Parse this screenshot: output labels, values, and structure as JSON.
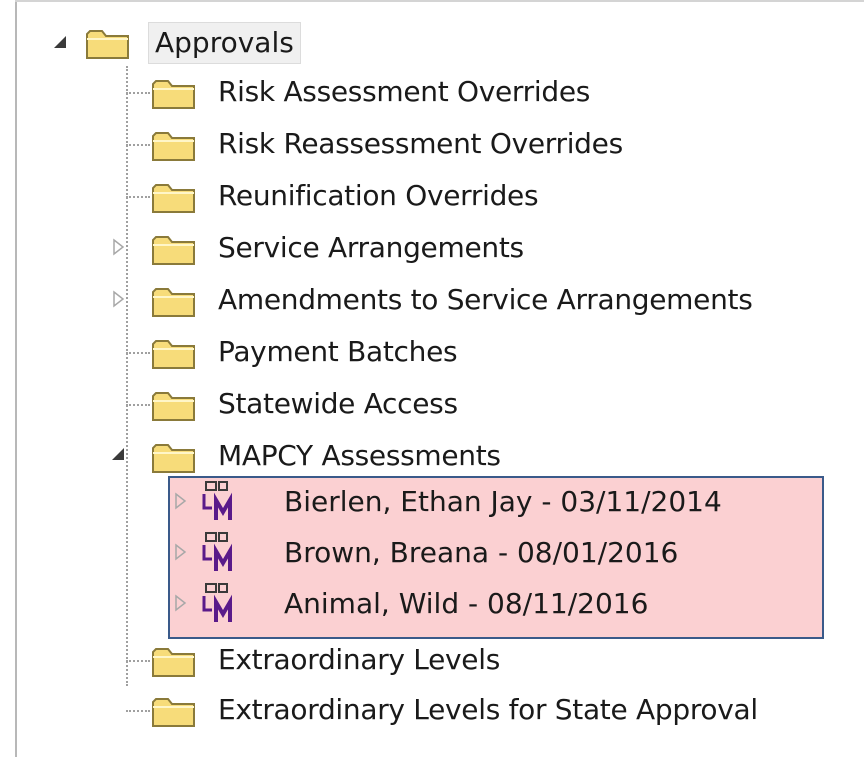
{
  "tree": {
    "root": {
      "label": "Approvals",
      "expanded": true
    },
    "items": [
      {
        "label": "Risk Assessment Overrides",
        "expandable": false
      },
      {
        "label": "Risk Reassessment Overrides",
        "expandable": false
      },
      {
        "label": "Reunification Overrides",
        "expandable": false
      },
      {
        "label": "Service Arrangements",
        "expandable": true,
        "expanded": false
      },
      {
        "label": "Amendments to Service Arrangements",
        "expandable": true,
        "expanded": false
      },
      {
        "label": "Payment Batches",
        "expandable": false
      },
      {
        "label": "Statewide Access",
        "expandable": false
      },
      {
        "label": "MAPCY Assessments",
        "expandable": true,
        "expanded": true,
        "children": [
          {
            "label": "Bierlen, Ethan Jay - 03/11/2014",
            "icon": "lm-assessment-icon"
          },
          {
            "label": "Brown, Breana - 08/01/2016",
            "icon": "lm-assessment-icon"
          },
          {
            "label": "Animal, Wild - 08/11/2016",
            "icon": "lm-assessment-icon"
          }
        ]
      },
      {
        "label": "Extraordinary Levels",
        "expandable": false
      },
      {
        "label": "Extraordinary Levels for State Approval",
        "expandable": false
      }
    ]
  },
  "colors": {
    "highlight_fill": "#fbd0d2",
    "highlight_border": "#3a5a8a",
    "folder_fill": "#f7dc7a",
    "folder_border": "#8a7a3a",
    "lm_icon": "#5a1a8a"
  }
}
